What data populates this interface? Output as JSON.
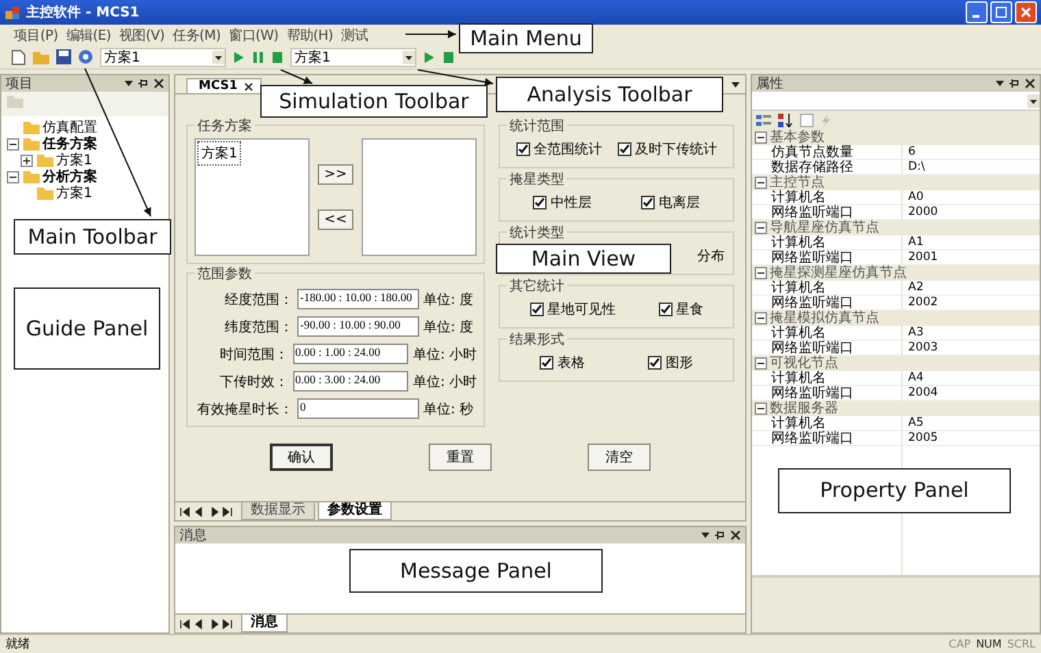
{
  "window": {
    "title": "主控软件 - MCS1"
  },
  "menu": [
    "项目(P)",
    "编辑(E)",
    "视图(V)",
    "任务(M)",
    "窗口(W)",
    "帮助(H)",
    "测试"
  ],
  "toolbar": {
    "simulation_combo": "方案1",
    "analysis_combo": "方案1"
  },
  "guide_panel": {
    "title": "项目",
    "tree": [
      {
        "label": "仿真配置",
        "kind": "item"
      },
      {
        "label": "任务方案",
        "kind": "category",
        "expanded": true,
        "children": [
          {
            "label": "方案1",
            "kind": "item",
            "expanded": false
          }
        ]
      },
      {
        "label": "分析方案",
        "kind": "category",
        "expanded": true,
        "children": [
          {
            "label": "方案1",
            "kind": "item"
          }
        ]
      }
    ]
  },
  "main_view": {
    "tab": "MCS1",
    "scheme_group": {
      "title": "任务方案",
      "left_items": [
        "方案1"
      ],
      "buttons": [
        ">>",
        "<<"
      ]
    },
    "range_group": {
      "title": "范围参数",
      "fields": [
        {
          "label": "经度范围：",
          "value": "-180.00 : 10.00 : 180.00",
          "unit": "单位: 度"
        },
        {
          "label": "纬度范围：",
          "value": "-90.00 : 10.00 : 90.00",
          "unit": "单位: 度"
        },
        {
          "label": "时间范围：",
          "value": "0.00 : 1.00 : 24.00",
          "unit": "单位: 小时"
        },
        {
          "label": "下传时效：",
          "value": "0.00 : 3.00 : 24.00",
          "unit": "单位: 小时"
        },
        {
          "label": "有效掩星时长：",
          "value": "0",
          "unit": "单位: 秒"
        }
      ]
    },
    "option_groups": [
      {
        "title": "统计范围",
        "options": [
          {
            "label": "全范围统计",
            "checked": true
          },
          {
            "label": "及时下传统计",
            "checked": true
          }
        ]
      },
      {
        "title": "掩星类型",
        "options": [
          {
            "label": "中性层",
            "checked": true
          },
          {
            "label": "电离层",
            "checked": true
          }
        ]
      },
      {
        "title": "统计类型",
        "fragment": "分布"
      },
      {
        "title": "其它统计",
        "options": [
          {
            "label": "星地可见性",
            "checked": true
          },
          {
            "label": "星食",
            "checked": true
          }
        ]
      },
      {
        "title": "结果形式",
        "options": [
          {
            "label": "表格",
            "checked": true
          },
          {
            "label": "图形",
            "checked": true
          }
        ]
      }
    ],
    "buttons": [
      "确认",
      "重置",
      "清空"
    ],
    "bottom_tabs": [
      {
        "label": "数据显示",
        "selected": false
      },
      {
        "label": "参数设置",
        "selected": true
      }
    ]
  },
  "message_panel": {
    "title": "消息",
    "tabs": [
      {
        "label": "消息",
        "selected": true
      }
    ]
  },
  "property_panel": {
    "title": "属性",
    "categories": [
      {
        "name": "基本参数",
        "expanded": true,
        "rows": [
          {
            "name": "仿真节点数量",
            "value": "6"
          },
          {
            "name": "数据存储路径",
            "value": "D:\\"
          }
        ]
      },
      {
        "name": "主控节点",
        "expanded": true,
        "rows": [
          {
            "name": "计算机名",
            "value": "A0"
          },
          {
            "name": "网络监听端口",
            "value": "2000"
          }
        ]
      },
      {
        "name": "导航星座仿真节点",
        "expanded": true,
        "rows": [
          {
            "name": "计算机名",
            "value": "A1"
          },
          {
            "name": "网络监听端口",
            "value": "2001"
          }
        ]
      },
      {
        "name": "掩星探测星座仿真节点",
        "expanded": true,
        "rows": [
          {
            "name": "计算机名",
            "value": "A2"
          },
          {
            "name": "网络监听端口",
            "value": "2002"
          }
        ]
      },
      {
        "name": "掩星模拟仿真节点",
        "expanded": true,
        "rows": [
          {
            "name": "计算机名",
            "value": "A3"
          },
          {
            "name": "网络监听端口",
            "value": "2003"
          }
        ]
      },
      {
        "name": "可视化节点",
        "expanded": true,
        "rows": [
          {
            "name": "计算机名",
            "value": "A4"
          },
          {
            "name": "网络监听端口",
            "value": "2004"
          }
        ]
      },
      {
        "name": "数据服务器",
        "expanded": true,
        "rows": [
          {
            "name": "计算机名",
            "value": "A5"
          },
          {
            "name": "网络监听端口",
            "value": "2005"
          }
        ]
      }
    ]
  },
  "status_bar": {
    "text": "就绪",
    "indicators": [
      {
        "label": "CAP",
        "on": false
      },
      {
        "label": "NUM",
        "on": true
      },
      {
        "label": "SCRL",
        "on": false
      }
    ]
  },
  "callouts": [
    {
      "label": "Main Menu"
    },
    {
      "label": "Main Toolbar"
    },
    {
      "label": "Simulation Toolbar"
    },
    {
      "label": "Analysis Toolbar"
    },
    {
      "label": "Guide Panel"
    },
    {
      "label": "Main View"
    },
    {
      "label": "Property Panel"
    },
    {
      "label": "Message Panel"
    }
  ]
}
